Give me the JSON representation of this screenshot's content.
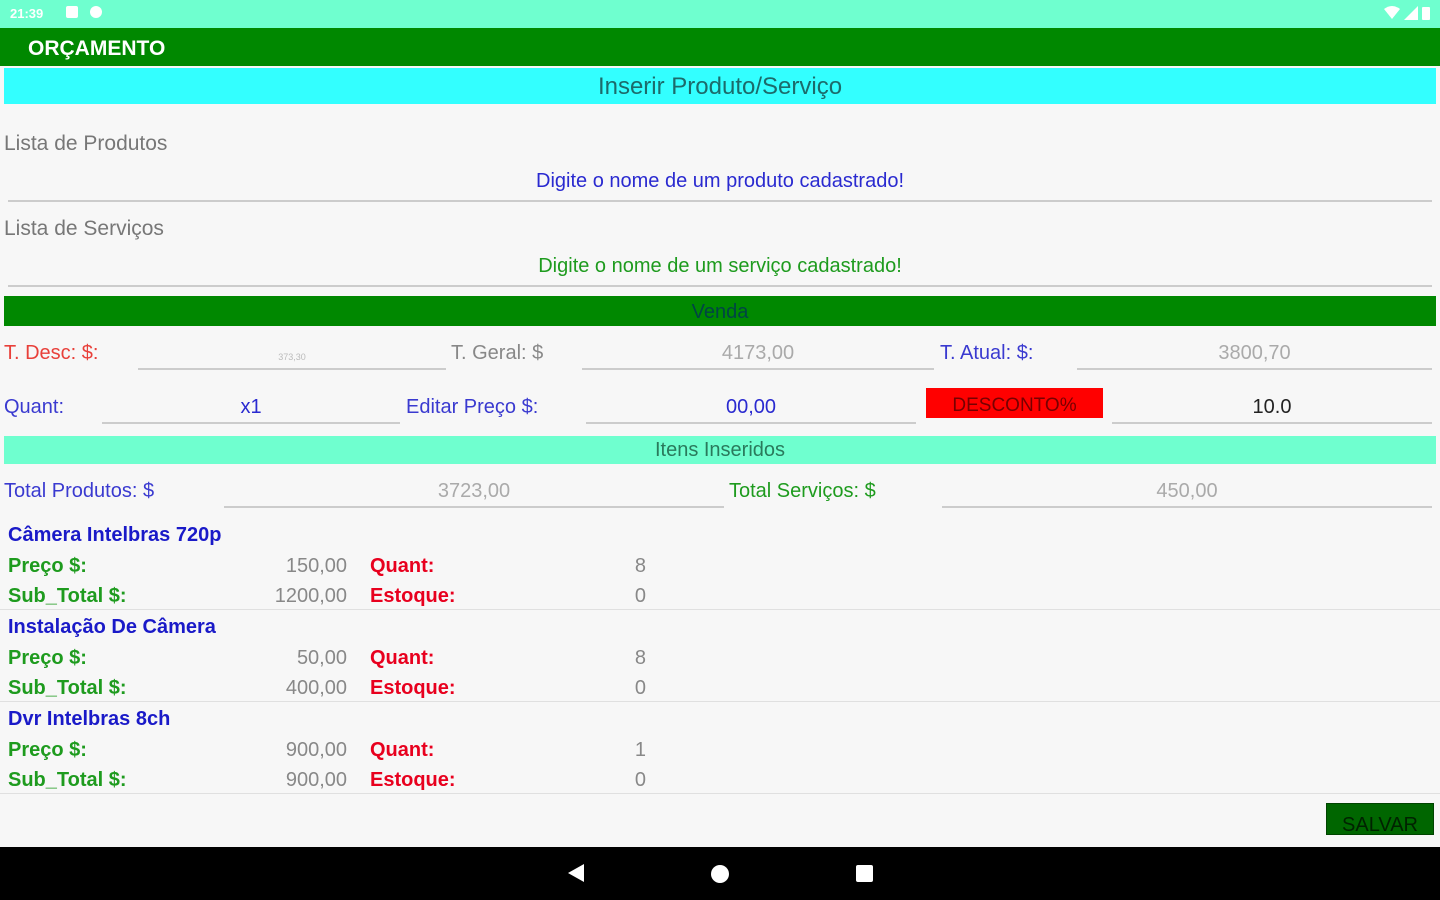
{
  "status_bar": {
    "time": "21:39"
  },
  "app_bar": {
    "title": "ORÇAMENTO"
  },
  "insert_section": {
    "title": "Inserir Produto/Serviço",
    "products_label": "Lista de Produtos",
    "products_placeholder": "Digite o nome de um produto cadastrado!",
    "services_label": "Lista de Serviços",
    "services_placeholder": "Digite o nome de um serviço cadastrado!"
  },
  "venda": {
    "title": "Venda",
    "t_desc_label": "T. Desc: $:",
    "t_desc_value": "373,30",
    "t_geral_label": "T. Geral: $",
    "t_geral_value": "4173,00",
    "t_atual_label": "T. Atual: $:",
    "t_atual_value": "3800,70",
    "quant_label": "Quant:",
    "quant_value": "x1",
    "editar_preco_label": "Editar Preço $:",
    "editar_preco_value": "00,00",
    "desconto_button": "DESCONTO%",
    "desconto_value": "10.0"
  },
  "itens": {
    "title": "Itens Inseridos",
    "total_produtos_label": "Total Produtos: $",
    "total_produtos_value": "3723,00",
    "total_servicos_label": "Total Serviços: $",
    "total_servicos_value": "450,00",
    "preco_label": "Preço $:",
    "subtotal_label": "Sub_Total $:",
    "quant_label": "Quant:",
    "estoque_label": "Estoque:",
    "list": [
      {
        "name": "Câmera Intelbras 720p",
        "preco": "150,00",
        "subtotal": "1200,00",
        "quant": "8",
        "estoque": "0"
      },
      {
        "name": "Instalação De Câmera",
        "preco": "50,00",
        "subtotal": "400,00",
        "quant": "8",
        "estoque": "0"
      },
      {
        "name": "Dvr Intelbras 8ch",
        "preco": "900,00",
        "subtotal": "900,00",
        "quant": "1",
        "estoque": "0"
      }
    ]
  },
  "salvar_button": "SALVAR",
  "colors": {
    "app_bar": "#008800",
    "status_bar": "#6fffcf",
    "insert_banner": "#33ffff",
    "desconto_button": "#ff0000",
    "itens_banner": "#6fffcf"
  }
}
